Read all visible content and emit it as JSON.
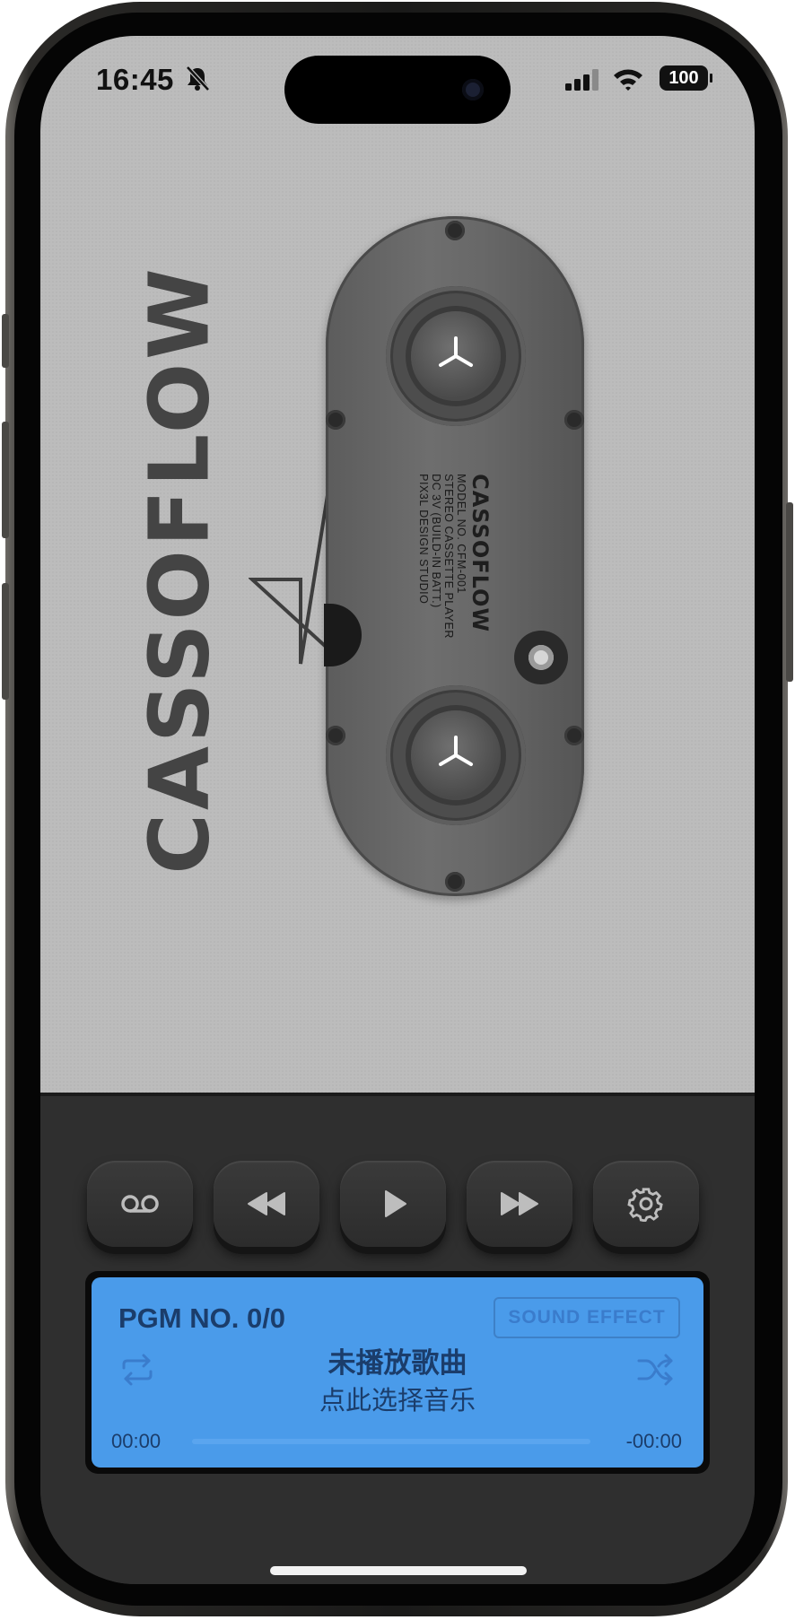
{
  "status_bar": {
    "time": "16:45",
    "battery": "100",
    "icons": [
      "bell-slash-icon",
      "cellular-signal-icon",
      "wifi-icon",
      "battery-icon"
    ]
  },
  "cassette": {
    "logo": "CASSOFLOW",
    "label_brand": "CASSOFLOW",
    "label_lines": [
      "MODEL NO. CFM-001",
      "STEREO CASSETTE PLAYER",
      "DC 3V (BUILD-IN BATT.)",
      "PIX3L DESIGN STUDIO"
    ]
  },
  "controls": {
    "buttons": [
      {
        "name": "cassette-button",
        "icon": "voicemail-icon"
      },
      {
        "name": "rewind-button",
        "icon": "backward-icon"
      },
      {
        "name": "play-button",
        "icon": "play-icon"
      },
      {
        "name": "fast-forward-button",
        "icon": "forward-icon"
      },
      {
        "name": "settings-button",
        "icon": "gear-icon"
      }
    ]
  },
  "display": {
    "program": "PGM NO. 0/0",
    "sound_effect": "SOUND EFFECT",
    "song_title": "未播放歌曲",
    "song_subtitle": "点此选择音乐",
    "time_elapsed": "00:00",
    "time_remaining": "-00:00",
    "progress": 0,
    "icons": [
      "repeat-icon",
      "shuffle-icon"
    ]
  },
  "colors": {
    "lcd_background": "#4a9bea",
    "lcd_text": "#1b3d6b",
    "deck_background": "#bcbcbc",
    "control_panel": "#2f2f2f"
  }
}
